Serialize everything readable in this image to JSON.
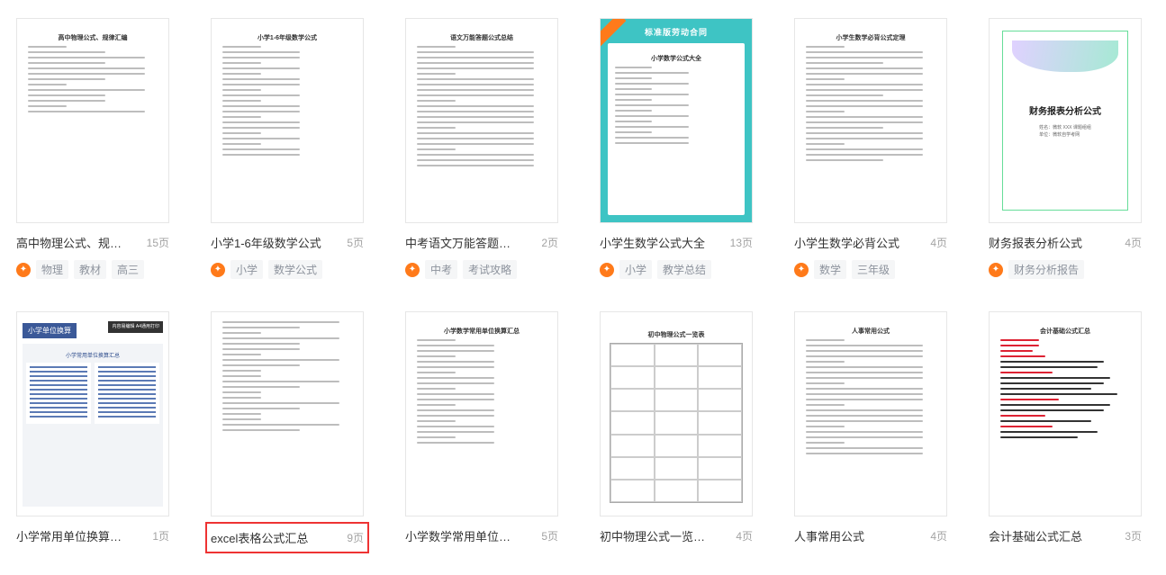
{
  "page_suffix": "页",
  "items": [
    {
      "title": "高中物理公式、规律…",
      "pages": 15,
      "tags": [
        "物理",
        "教材",
        "高三"
      ],
      "thumb": {
        "variant": "a",
        "heading": "高中物理公式、规律汇编"
      }
    },
    {
      "title": "小学1-6年级数学公式",
      "pages": 5,
      "tags": [
        "小学",
        "数学公式"
      ],
      "thumb": {
        "variant": "b",
        "heading": "小学1-6年级数学公式"
      }
    },
    {
      "title": "中考语文万能答题公式…",
      "pages": 2,
      "tags": [
        "中考",
        "考试攻略"
      ],
      "thumb": {
        "variant": "c",
        "heading": "语文万能答题公式总结"
      }
    },
    {
      "title": "小学生数学公式大全",
      "pages": 13,
      "tags": [
        "小学",
        "教学总结"
      ],
      "thumb": {
        "variant": "d",
        "heading": "小学数学公式大全",
        "banner": "标准版劳动合同"
      }
    },
    {
      "title": "小学生数学必背公式",
      "pages": 4,
      "tags": [
        "数学",
        "三年级"
      ],
      "thumb": {
        "variant": "e",
        "heading": "小学生数学必背公式定理"
      }
    },
    {
      "title": "财务报表分析公式",
      "pages": 4,
      "tags": [
        "财务分析报告"
      ],
      "thumb": {
        "variant": "f",
        "heading": "财务报表分析公式",
        "sub1": "姓名：微软 XXX 课题组组",
        "sub2": "单位：微软自学考网"
      }
    },
    {
      "title": "小学常用单位换算汇总…",
      "pages": 1,
      "tags": [],
      "thumb": {
        "variant": "g",
        "heading": "小学常用单位换算汇总",
        "badge": "小学单位换算",
        "badge2": "内容易编辑\nA4通用打印"
      }
    },
    {
      "title": "excel表格公式汇总",
      "pages": 9,
      "tags": [],
      "highlight": true,
      "thumb": {
        "variant": "h",
        "heading": ""
      }
    },
    {
      "title": "小学数学常用单位换算…",
      "pages": 5,
      "tags": [],
      "thumb": {
        "variant": "i",
        "heading": "小学数学常用单位换算汇总"
      }
    },
    {
      "title": "初中物理公式一览汇总…",
      "pages": 4,
      "tags": [],
      "thumb": {
        "variant": "j",
        "heading": "初中物理公式一览表"
      }
    },
    {
      "title": "人事常用公式",
      "pages": 4,
      "tags": [],
      "thumb": {
        "variant": "k",
        "heading": "人事常用公式"
      }
    },
    {
      "title": "会计基础公式汇总",
      "pages": 3,
      "tags": [],
      "thumb": {
        "variant": "l",
        "heading": "会计基础公式汇总"
      }
    }
  ]
}
